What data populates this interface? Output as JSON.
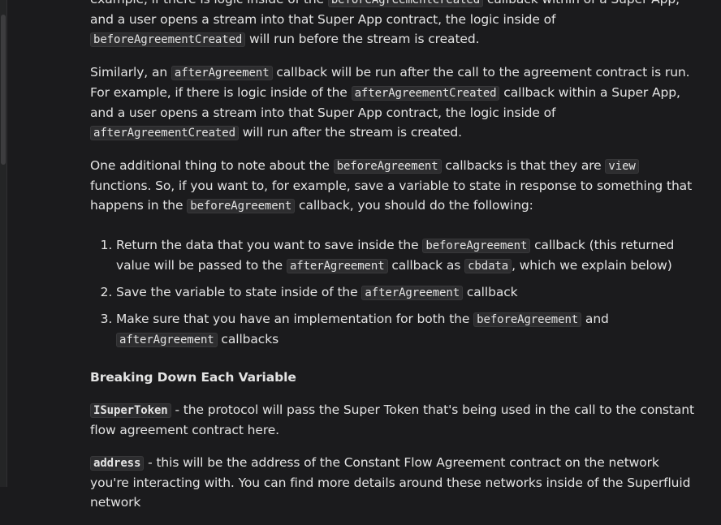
{
  "para0": {
    "t1": "example, if there is logic inside of the ",
    "c1": "beforeAgreementCreated",
    "t2": " callback within of a Super App, and a user opens a stream into that Super App contract, the logic inside of ",
    "c2": "beforeAgreementCreated",
    "t3": " will run before the stream is created."
  },
  "para1": {
    "t1": "Similarly, an ",
    "c1": "afterAgreement",
    "t2": " callback will be run after the call to the agreement contract is run. For example, if there is logic inside of the ",
    "c2": "afterAgreementCreated",
    "t3": " callback within a Super App, and a user opens a stream into that Super App contract, the logic inside of ",
    "c3": "afterAgreementCreated",
    "t4": " will run after the stream is created."
  },
  "para2": {
    "t1": "One additional thing to note about the ",
    "c1": "beforeAgreement",
    "t2": " callbacks is that they are ",
    "c2": "view",
    "t3": " functions. So, if you want to, for example, save a variable to state in response to something that happens in the ",
    "c3": "beforeAgreement",
    "t4": " callback, you should do the following:"
  },
  "list": [
    {
      "t1": "Return the data that you want to save inside the ",
      "c1": "beforeAgreement",
      "t2": " callback (this returned value will be passed to the ",
      "c2": "afterAgreement",
      "t3": " callback as ",
      "c3": "cbdata",
      "t4": ", which we explain below)"
    },
    {
      "t1": "Save the variable to state inside of the ",
      "c1": "afterAgreement",
      "t2": " callback"
    },
    {
      "t1": "Make sure that you have an implementation for both the ",
      "c1": "beforeAgreement",
      "t2": " and ",
      "c2": "afterAgreement",
      "t3": " callbacks"
    }
  ],
  "heading": "Breaking Down Each Variable",
  "var1": {
    "code": "ISuperToken",
    "text": " - the protocol will pass the Super Token that's being used in the call to the constant flow agreement contract here."
  },
  "var2": {
    "code": "address",
    "text": " - this will be the address of the Constant Flow Agreement contract on the network you're interacting with. You can find more details around these networks inside of the Superfluid network"
  }
}
